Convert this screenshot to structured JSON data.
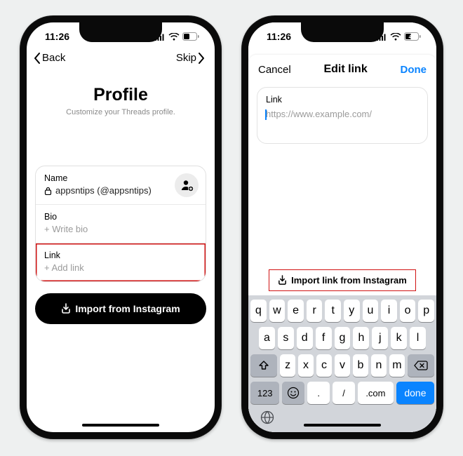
{
  "status": {
    "time": "11:26",
    "battery": "42"
  },
  "left": {
    "back": "Back",
    "skip": "Skip",
    "title": "Profile",
    "subtitle": "Customize your Threads profile.",
    "name_label": "Name",
    "name_value": "appsntips (@appsntips)",
    "bio_label": "Bio",
    "bio_placeholder": "+ Write bio",
    "link_label": "Link",
    "link_placeholder": "+ Add link",
    "import_btn": "Import from Instagram"
  },
  "right": {
    "cancel": "Cancel",
    "title": "Edit link",
    "done": "Done",
    "link_label": "Link",
    "link_placeholder": "https://www.example.com/",
    "import_link": "Import link from Instagram"
  },
  "keyboard": {
    "row1": [
      "q",
      "w",
      "e",
      "r",
      "t",
      "y",
      "u",
      "i",
      "o",
      "p"
    ],
    "row2": [
      "a",
      "s",
      "d",
      "f",
      "g",
      "h",
      "j",
      "k",
      "l"
    ],
    "row3": [
      "z",
      "x",
      "c",
      "v",
      "b",
      "n",
      "m"
    ],
    "num": "123",
    "dot": ".",
    "slash": "/",
    "dotcom": ".com",
    "done": "done"
  }
}
